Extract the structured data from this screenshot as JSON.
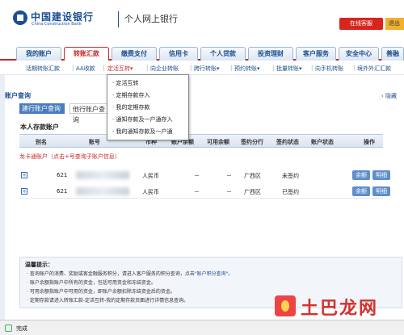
{
  "header": {
    "bank_name_cn": "中国建设银行",
    "bank_name_en": "China Construction Bank",
    "site_title": "个人网上银行",
    "online_service_button": "在线客服",
    "exit_button": "退出"
  },
  "tabs": [
    {
      "label": "我的账户"
    },
    {
      "label": "转账汇款"
    },
    {
      "label": "缴费支付"
    },
    {
      "label": "信用卡"
    },
    {
      "label": "个人贷款"
    },
    {
      "label": "投资理财"
    },
    {
      "label": "客户服务"
    },
    {
      "label": "安全中心"
    },
    {
      "label": "善融"
    }
  ],
  "subnav": [
    {
      "label": "活期转账汇款"
    },
    {
      "label": "AA收款"
    },
    {
      "label": "定活互转▾"
    },
    {
      "label": "向企业转账"
    },
    {
      "label": "跨行转账▾"
    },
    {
      "label": "预约转账▾"
    },
    {
      "label": "批量转账▾"
    },
    {
      "label": "向手机转账"
    },
    {
      "label": "境外外汇汇款"
    }
  ],
  "dropdown": {
    "items": [
      "定活互转",
      "定期存款存入",
      "我的定期存款",
      "通知存款及一户通存入",
      "我的通知存款及一户通"
    ]
  },
  "panel": {
    "title": "账户查询",
    "hide_link": "隐藏",
    "mini_tabs": [
      "建行账户查询",
      "他行账户查询"
    ],
    "section_title": "本人存款账户"
  },
  "table": {
    "headers": [
      "别名",
      "账号",
      "币种",
      "账户余额",
      "可用余额",
      "签约分行",
      "签约状态",
      "账户状态",
      "操作"
    ],
    "group_label": "龙卡通账户（点击+号查询子账户信息）",
    "rows": [
      {
        "expander": "+",
        "account_prefix": "621",
        "currency": "人民币",
        "balance": "－",
        "available": "－",
        "branch": "广西区",
        "sign_status": "未签约",
        "account_status": "",
        "actions": [
          "余额",
          "明细"
        ]
      },
      {
        "expander": "+",
        "account_prefix": "621",
        "currency": "人民币",
        "balance": "－",
        "available": "－",
        "branch": "广西区",
        "sign_status": "已签约",
        "account_status": "",
        "actions": [
          "余额",
          "明细"
        ]
      }
    ]
  },
  "tips": {
    "title": "温馨提示：",
    "lines": [
      {
        "text": "· 查询账户的消费、奖励或客金融服务积分，请进入客户服务的积分查询，点击",
        "link": "\"账户积分查询\"。"
      },
      {
        "text": "· 账户余额指账户中所有的资金，包括可用资金和冻结资金。",
        "link": ""
      },
      {
        "text": "· 可用余额指账户中可用的资金，即账户余额扣除冻结资金后的资金。",
        "link": ""
      },
      {
        "text": "· 定期存款请进入转账汇款-定活互转-我的定期存款页面进行详情信息查询。",
        "link": ""
      }
    ]
  },
  "statusbar": {
    "text": "完成"
  },
  "watermark": {
    "text": "土巴龙网"
  }
}
